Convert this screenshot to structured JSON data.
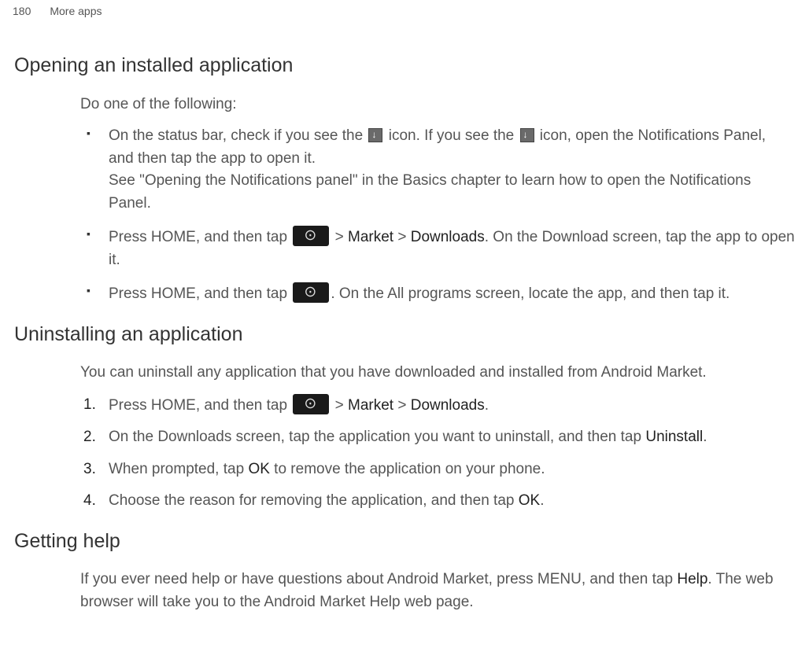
{
  "header": {
    "page_num": "180",
    "section_name": "More apps"
  },
  "section1": {
    "heading": "Opening an installed application",
    "intro": "Do one of the following:",
    "bullet1_a": "On the status bar, check if you see the ",
    "bullet1_b": " icon. If you see the ",
    "bullet1_c": " icon, open the Notifications Panel, and then tap the app to open it.",
    "bullet1_d": "See \"Opening the Notifications panel\" in the Basics chapter to learn how to open the Notifications Panel.",
    "bullet2_a": "Press HOME, and then tap ",
    "bullet2_b": " > ",
    "bullet2_market": "Market",
    "bullet2_c": " > ",
    "bullet2_downloads": "Downloads",
    "bullet2_d": ". On the Download screen, tap the app to open it.",
    "bullet3_a": "Press HOME, and then tap ",
    "bullet3_b": ". On the All programs screen, locate the app, and then tap it."
  },
  "section2": {
    "heading": "Uninstalling an application",
    "intro": "You can uninstall any application that you have downloaded and installed from Android Market.",
    "step1_a": "Press HOME, and then tap ",
    "step1_b": " > ",
    "step1_market": "Market",
    "step1_c": " > ",
    "step1_downloads": "Downloads",
    "step1_d": ".",
    "step2_a": "On the Downloads screen, tap the application you want to uninstall, and then tap ",
    "step2_uninstall": "Uninstall",
    "step2_b": ".",
    "step3_a": "When prompted, tap ",
    "step3_ok": "OK",
    "step3_b": " to remove the application on your phone.",
    "step4_a": "Choose the reason for removing the application, and then tap ",
    "step4_ok": "OK",
    "step4_b": "."
  },
  "section3": {
    "heading": "Getting help",
    "body_a": "If you ever need help or have questions about Android Market, press MENU, and then tap ",
    "body_help": "Help",
    "body_b": ". The web browser will take you to the Android Market Help web page."
  }
}
